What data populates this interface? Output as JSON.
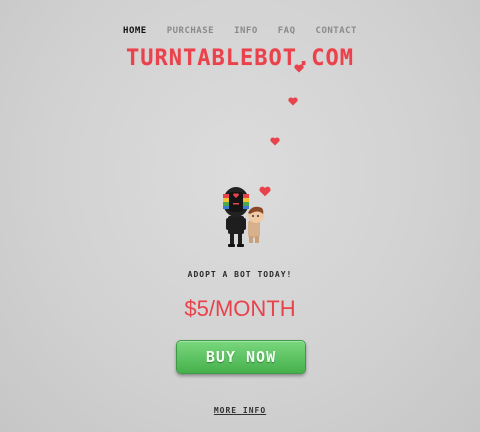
{
  "nav": {
    "items": [
      {
        "label": "HOME",
        "active": true
      },
      {
        "label": "PURCHASE",
        "active": false
      },
      {
        "label": "INFO",
        "active": false
      },
      {
        "label": "FAQ",
        "active": false
      },
      {
        "label": "CONTACT",
        "active": false
      }
    ]
  },
  "logo": {
    "text": "TURNTABLEBOT.COM"
  },
  "hero": {
    "heart_icon": "heart-icon",
    "bot_icon": "turntable-bot-illustration"
  },
  "offer": {
    "tagline": "ADOPT A BOT TODAY!",
    "price": "$5/MONTH",
    "buy_label": "BUY NOW",
    "more_info_label": "MORE INFO"
  },
  "colors": {
    "accent": "#e8424c",
    "button": "#56c25c"
  }
}
